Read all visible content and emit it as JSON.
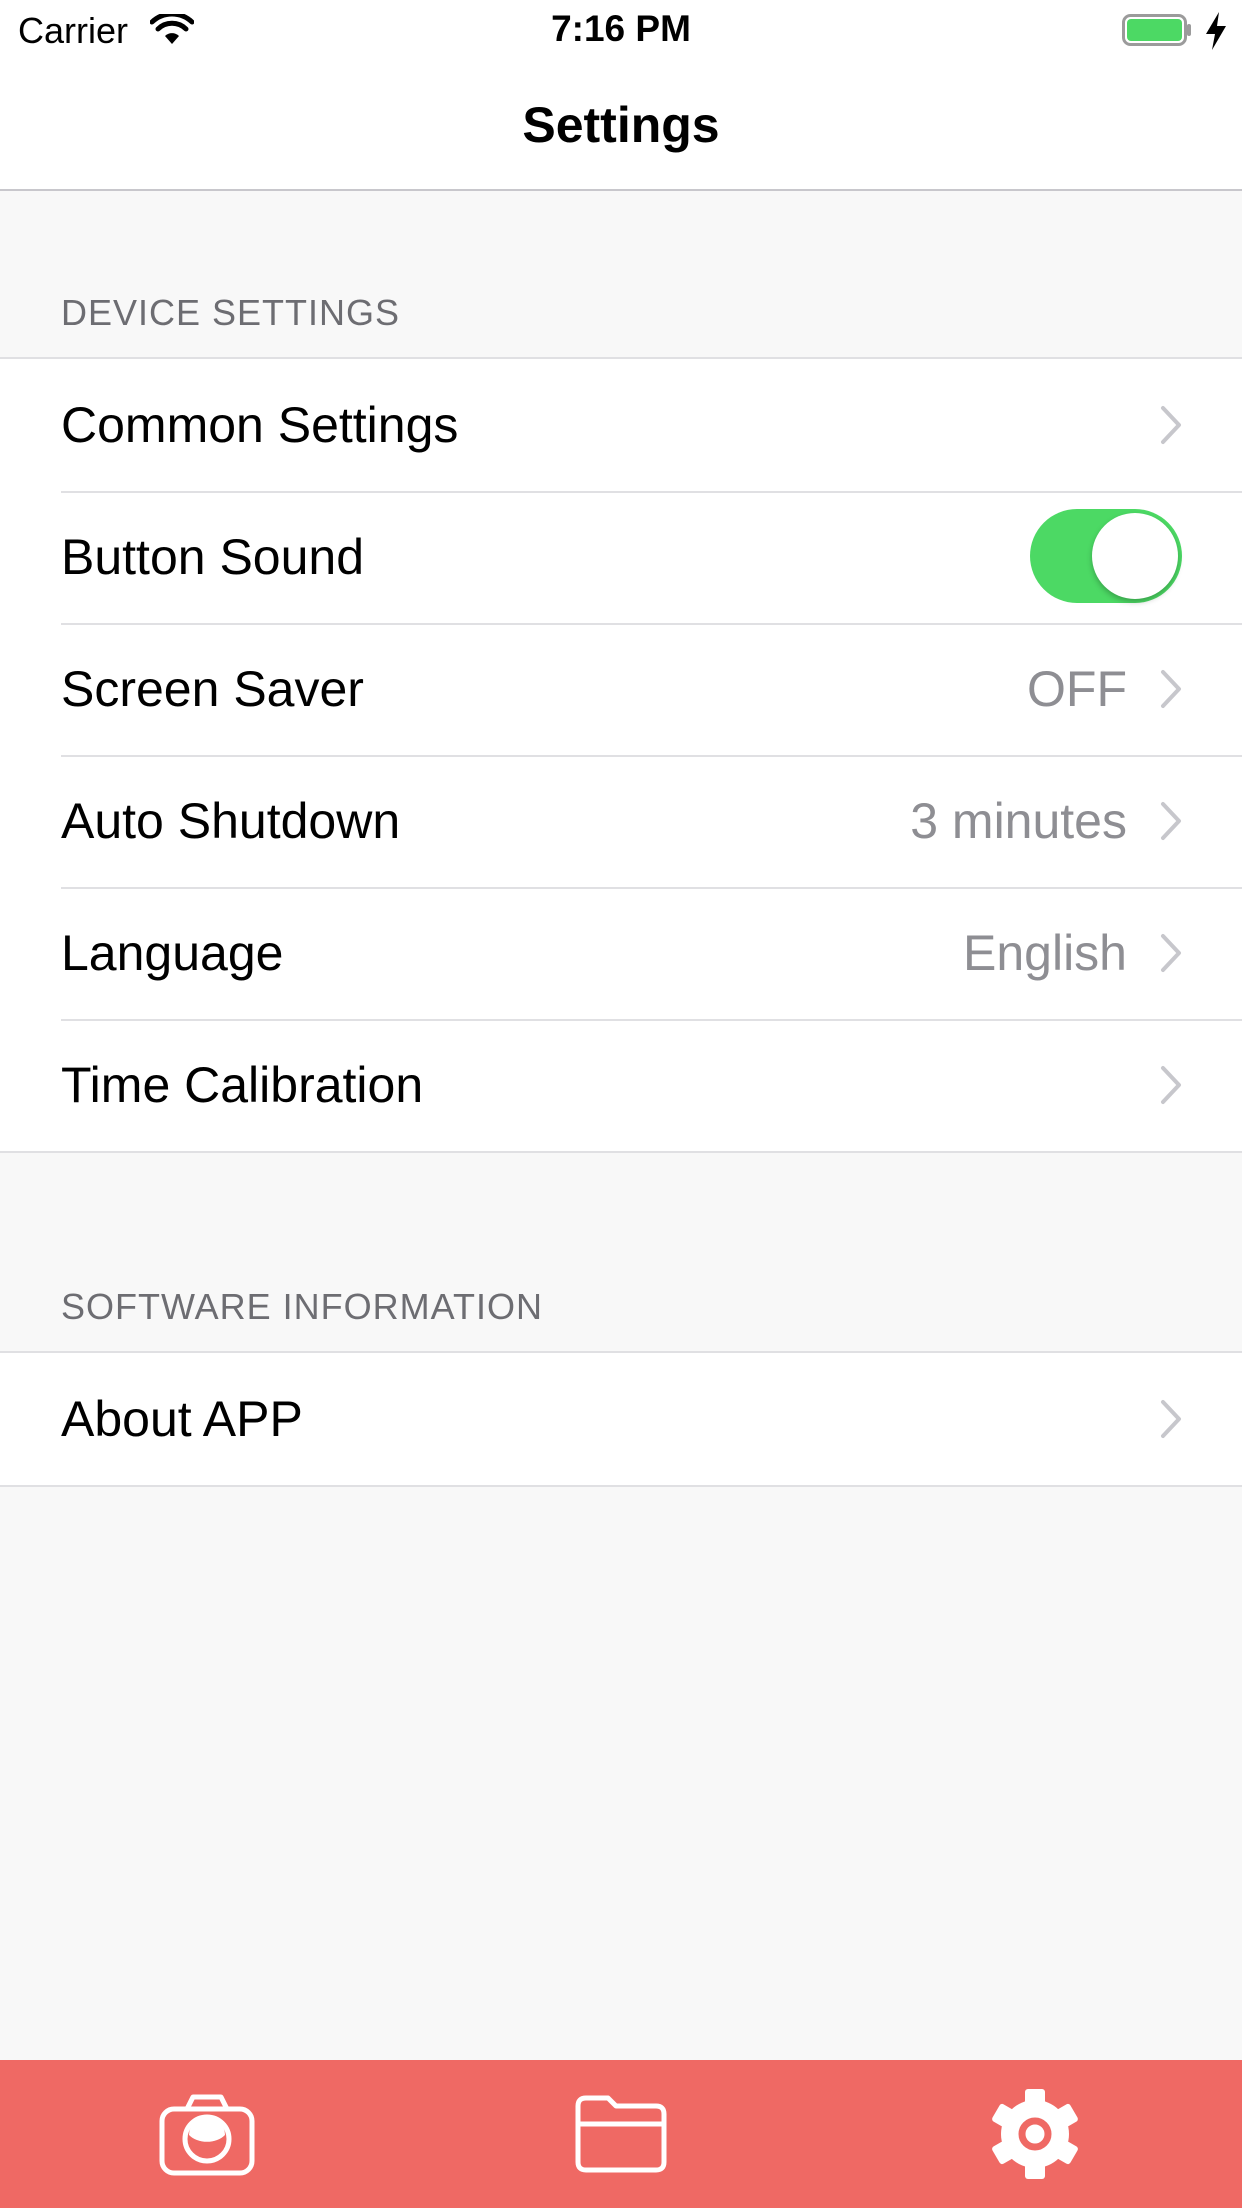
{
  "status_bar": {
    "carrier": "Carrier",
    "time": "7:16 PM",
    "battery_color": "#4cd964"
  },
  "nav": {
    "title": "Settings"
  },
  "sections": [
    {
      "header": "DEVICE SETTINGS",
      "rows": [
        {
          "label": "Common Settings",
          "value": "",
          "accessory": "chevron"
        },
        {
          "label": "Button Sound",
          "accessory": "toggle",
          "toggle_on": true
        },
        {
          "label": "Screen Saver",
          "value": "OFF",
          "accessory": "chevron"
        },
        {
          "label": "Auto Shutdown",
          "value": "3 minutes",
          "accessory": "chevron"
        },
        {
          "label": "Language",
          "value": "English",
          "accessory": "chevron"
        },
        {
          "label": "Time Calibration",
          "value": "",
          "accessory": "chevron"
        }
      ]
    },
    {
      "header": "SOFTWARE INFORMATION",
      "rows": [
        {
          "label": "About APP",
          "value": "",
          "accessory": "chevron"
        }
      ]
    }
  ],
  "tab_bar": {
    "background": "#ef6964",
    "tabs": [
      {
        "icon": "camera-icon"
      },
      {
        "icon": "folder-icon"
      },
      {
        "icon": "gear-icon",
        "selected": true
      }
    ]
  },
  "colors": {
    "toggle_on": "#4cd964",
    "accent": "#ef6964"
  }
}
